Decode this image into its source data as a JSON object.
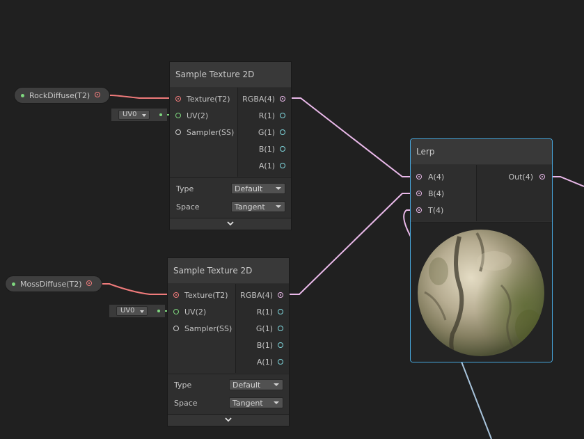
{
  "properties": {
    "rock": {
      "label": "RockDiffuse(T2)"
    },
    "moss": {
      "label": "MossDiffuse(T2)"
    }
  },
  "sample_nodes": [
    {
      "title": "Sample Texture 2D",
      "uv_channel": "UV0",
      "inputs": [
        "Texture(T2)",
        "UV(2)",
        "Sampler(SS)"
      ],
      "outputs": [
        "RGBA(4)",
        "R(1)",
        "G(1)",
        "B(1)",
        "A(1)"
      ],
      "type_label": "Type",
      "type_value": "Default",
      "space_label": "Space",
      "space_value": "Tangent"
    },
    {
      "title": "Sample Texture 2D",
      "uv_channel": "UV0",
      "inputs": [
        "Texture(T2)",
        "UV(2)",
        "Sampler(SS)"
      ],
      "outputs": [
        "RGBA(4)",
        "R(1)",
        "G(1)",
        "B(1)",
        "A(1)"
      ],
      "type_label": "Type",
      "type_value": "Default",
      "space_label": "Space",
      "space_value": "Tangent"
    }
  ],
  "lerp_node": {
    "title": "Lerp",
    "inputs": [
      "A(4)",
      "B(4)",
      "T(4)"
    ],
    "outputs": [
      "Out(4)"
    ]
  },
  "colors": {
    "background": "#202020",
    "texture_port": "#f07b7b",
    "vector2_port": "#7fd87f",
    "vector4_port": "#eab9ea",
    "float_port": "#7fd6dc",
    "selection": "#48a9e0"
  },
  "icons": {
    "expand": "chevron-down-icon",
    "dropdown": "caret-down-icon"
  }
}
